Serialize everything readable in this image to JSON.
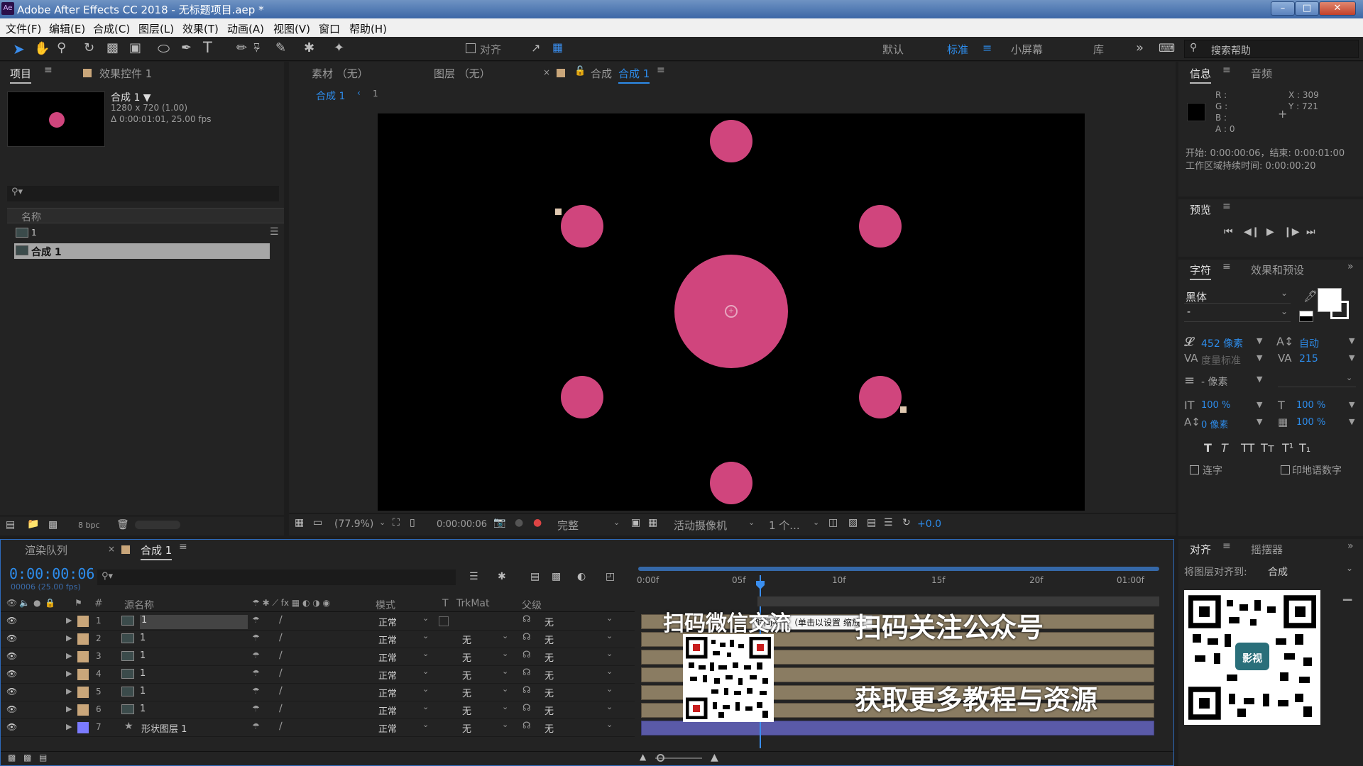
{
  "title": "Adobe After Effects CC 2018 - 无标题项目.aep *",
  "app_icon": "Ae",
  "menu": [
    "文件(F)",
    "编辑(E)",
    "合成(C)",
    "图层(L)",
    "效果(T)",
    "动画(A)",
    "视图(V)",
    "窗口",
    "帮助(H)"
  ],
  "toolbar": {
    "snap_label": "对齐",
    "workspaces": [
      "默认",
      "标准",
      "小屏幕",
      "库"
    ],
    "search_placeholder": "搜索帮助"
  },
  "project": {
    "tab": "项目",
    "effects_tab": "效果控件 1",
    "comp_name": "合成 1 ▼",
    "dims": "1280 x 720 (1.00)",
    "duration": "Δ 0:00:01:01, 25.00 fps",
    "col_name": "名称",
    "items": [
      "1",
      "合成 1"
    ],
    "bpc": "8 bpc"
  },
  "viewer": {
    "tab_footage": "素材 （无）",
    "tab_layer": "图层 （无）",
    "tab_comp_prefix": "合成",
    "tab_comp_name": "合成 1",
    "breadcrumb": "合成 1",
    "breadcrumb_count": "1",
    "zoom": "(77.9%)",
    "time": "0:00:00:06",
    "quality": "完整",
    "camera": "活动摄像机",
    "views": "1 个...",
    "exposure": "+0.0"
  },
  "info": {
    "tab": "信息",
    "audio_tab": "音频",
    "r": "R :",
    "g": "G :",
    "b": "B :",
    "a": "A : 0",
    "x": "X : 309",
    "y": "Y : 721",
    "start_end": "开始: 0:00:00:06，结束: 0:00:01:00",
    "work_area": "工作区域持续时间: 0:00:00:20"
  },
  "preview": {
    "tab": "预览"
  },
  "character": {
    "tab": "字符",
    "effects_tab": "效果和预设",
    "font": "黑体",
    "style": "-",
    "size": "452 像素",
    "leading": "自动",
    "kerning": "度量标准",
    "tracking": "215",
    "stroke": "- 像素",
    "vscale": "100 %",
    "hscale": "100 %",
    "baseline": "0 像素",
    "tsume": "100 %",
    "styles": [
      "T",
      "T",
      "TT",
      "Tт",
      "T¹",
      "T₁"
    ],
    "ligatures": "连字",
    "hindi": "印地语数字"
  },
  "align": {
    "tab": "对齐",
    "wiggler_tab": "摇摆器",
    "align_to_label": "将图层对齐到:",
    "align_to": "合成"
  },
  "timeline": {
    "render_tab": "渲染队列",
    "comp_tab": "合成 1",
    "timecode": "0:00:00:06",
    "timecode_sub": "00006 (25.00 fps)",
    "col_source": "源名称",
    "col_mode": "模式",
    "col_t": "T",
    "col_trkmat": "TrkMat",
    "col_parent": "父级",
    "ruler": [
      "0:00f",
      "05f",
      "10f",
      "15f",
      "20f",
      "01:00f"
    ],
    "tooltip": "时间标尺（单击以设置 缩放）",
    "layers": [
      {
        "num": "1",
        "name": "1",
        "mode": "正常",
        "trkmat": "",
        "parent": "无",
        "color": "#c9a67a"
      },
      {
        "num": "2",
        "name": "1",
        "mode": "正常",
        "trkmat": "无",
        "parent": "无",
        "color": "#c9a67a"
      },
      {
        "num": "3",
        "name": "1",
        "mode": "正常",
        "trkmat": "无",
        "parent": "无",
        "color": "#c9a67a"
      },
      {
        "num": "4",
        "name": "1",
        "mode": "正常",
        "trkmat": "无",
        "parent": "无",
        "color": "#c9a67a"
      },
      {
        "num": "5",
        "name": "1",
        "mode": "正常",
        "trkmat": "无",
        "parent": "无",
        "color": "#c9a67a"
      },
      {
        "num": "6",
        "name": "1",
        "mode": "正常",
        "trkmat": "无",
        "parent": "无",
        "color": "#c9a67a"
      },
      {
        "num": "7",
        "name": "形状图层 1",
        "mode": "正常",
        "trkmat": "无",
        "parent": "无",
        "color": "#7b7bff"
      }
    ]
  },
  "overlay": {
    "scan_wechat": "扫码微信交流",
    "scan_public": "扫码关注公众号",
    "get_more": "获取更多教程与资源",
    "qr_logo": "影视"
  }
}
